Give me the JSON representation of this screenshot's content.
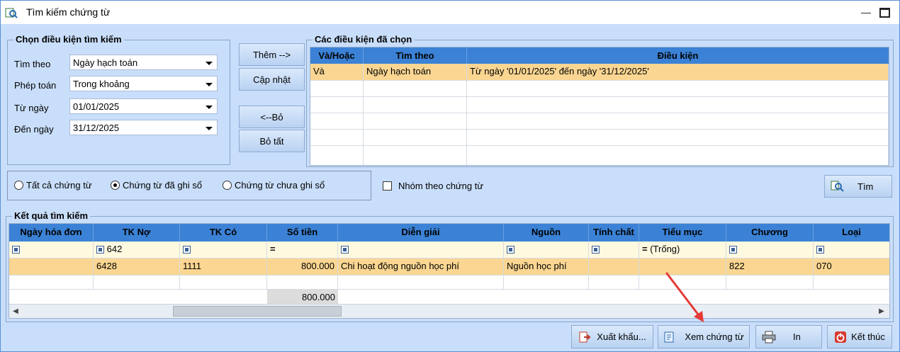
{
  "window": {
    "title": "Tìm kiếm chứng từ"
  },
  "search_conditions": {
    "group_title": "Chọn điều kiện tìm kiếm",
    "search_by_label": "Tìm theo",
    "search_by_value": "Ngày hạch toán",
    "operator_label": "Phép toán",
    "operator_value": "Trong khoảng",
    "from_label": "Từ ngày",
    "from_value": "01/01/2025",
    "to_label": "Đến ngày",
    "to_value": "31/12/2025"
  },
  "actions": {
    "add": "Thêm -->",
    "update": "Cập nhật",
    "remove": "<--Bỏ",
    "remove_all": "Bỏ tất"
  },
  "selected_conditions": {
    "group_title": "Các điều kiện đã chọn",
    "headers": [
      "Và/Hoặc",
      "Tìm theo",
      "Điều kiện"
    ],
    "rows": [
      [
        "Và",
        "Ngày hạch toán",
        "Từ ngày '01/01/2025' đến ngày '31/12/2025'"
      ]
    ]
  },
  "filters": {
    "all": "Tất cả chứng từ",
    "posted": "Chứng từ đã ghi sổ",
    "unposted": "Chứng từ chưa ghi sổ",
    "selected": "posted",
    "group_by": "Nhóm theo chứng từ",
    "search_button": "Tìm"
  },
  "results": {
    "group_title": "Kết quả tìm kiếm",
    "headers": [
      "Ngày hóa đơn",
      "TK Nợ",
      "TK Có",
      "Số tiền",
      "Diễn giải",
      "Nguồn",
      "Tính chất",
      "Tiểu mục",
      "Chương",
      "Loại"
    ],
    "filter_row": {
      "tk_no": "642",
      "tieu_muc": "(Trống)"
    },
    "rows": [
      [
        "",
        "6428",
        "1111",
        "800.000",
        "Chi hoạt động nguồn học phí",
        "Nguồn học phí",
        "",
        "",
        "822",
        "070"
      ]
    ],
    "total": "800.000"
  },
  "footer": {
    "export": "Xuất khẩu...",
    "view": "Xem chứng từ",
    "print": "In",
    "close": "Kết thúc"
  },
  "colors": {
    "header_blue": "#3b82d6",
    "selected_row": "#fad692",
    "window_bg": "#c9defa"
  }
}
